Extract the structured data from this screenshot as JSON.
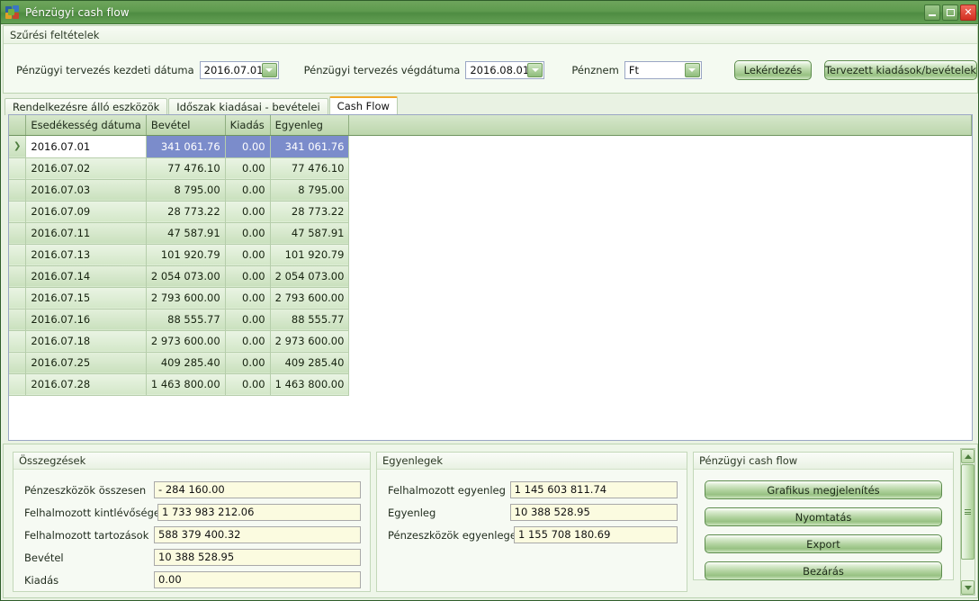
{
  "window": {
    "title": "Pénzügyi cash flow",
    "icon": "app-icon",
    "minimize_label": "",
    "maximize_label": "",
    "close_label": "✕"
  },
  "filter_panel": {
    "caption": "Szűrési feltételek",
    "start_date_label": "Pénzügyi tervezés kezdeti dátuma",
    "start_date_value": "2016.07.01",
    "end_date_label": "Pénzügyi tervezés végdátuma",
    "end_date_value": "2016.08.01",
    "currency_label": "Pénznem",
    "currency_value": "Ft",
    "query_button": "Lekérdezés",
    "planned_button": "Tervezett kiadások/bevételek"
  },
  "tabs": [
    {
      "label": "Rendelkezésre álló eszközök",
      "active": false
    },
    {
      "label": "Időszak kiadásai - bevételei",
      "active": false
    },
    {
      "label": "Cash Flow",
      "active": true
    }
  ],
  "grid": {
    "columns": [
      "Esedékesség dátuma",
      "Bevétel",
      "Kiadás",
      "Egyenleg"
    ],
    "selected_row_index": 0,
    "rows": [
      {
        "date": "2016.07.01",
        "income": "341 061.76",
        "expense": "0.00",
        "balance": "341 061.76"
      },
      {
        "date": "2016.07.02",
        "income": "77 476.10",
        "expense": "0.00",
        "balance": "77 476.10"
      },
      {
        "date": "2016.07.03",
        "income": "8 795.00",
        "expense": "0.00",
        "balance": "8 795.00"
      },
      {
        "date": "2016.07.09",
        "income": "28 773.22",
        "expense": "0.00",
        "balance": "28 773.22"
      },
      {
        "date": "2016.07.11",
        "income": "47 587.91",
        "expense": "0.00",
        "balance": "47 587.91"
      },
      {
        "date": "2016.07.13",
        "income": "101 920.79",
        "expense": "0.00",
        "balance": "101 920.79"
      },
      {
        "date": "2016.07.14",
        "income": "2 054 073.00",
        "expense": "0.00",
        "balance": "2 054 073.00"
      },
      {
        "date": "2016.07.15",
        "income": "2 793 600.00",
        "expense": "0.00",
        "balance": "2 793 600.00"
      },
      {
        "date": "2016.07.16",
        "income": "88 555.77",
        "expense": "0.00",
        "balance": "88 555.77"
      },
      {
        "date": "2016.07.18",
        "income": "2 973 600.00",
        "expense": "0.00",
        "balance": "2 973 600.00"
      },
      {
        "date": "2016.07.25",
        "income": "409 285.40",
        "expense": "0.00",
        "balance": "409 285.40"
      },
      {
        "date": "2016.07.28",
        "income": "1 463 800.00",
        "expense": "0.00",
        "balance": "1 463 800.00"
      }
    ]
  },
  "summary_box": {
    "caption": "Összegzések",
    "fields": [
      {
        "label": "Pénzeszközök összesen",
        "value": "- 284 160.00"
      },
      {
        "label": "Felhalmozott kintlévőségek",
        "value": "1 733 983 212.06"
      },
      {
        "label": "Felhalmozott tartozások",
        "value": "588 379 400.32"
      },
      {
        "label": "Bevétel",
        "value": "10 388 528.95"
      },
      {
        "label": "Kiadás",
        "value": "0.00"
      }
    ]
  },
  "balances_box": {
    "caption": "Egyenlegek",
    "fields": [
      {
        "label": "Felhalmozott egyenleg",
        "value": "1 145 603 811.74"
      },
      {
        "label": "Egyenleg",
        "value": "10 388 528.95"
      },
      {
        "label": "Pénzeszközök egyenlege",
        "value": "1 155 708 180.69"
      }
    ]
  },
  "actions_box": {
    "caption": "Pénzügyi cash flow",
    "buttons": [
      {
        "label": "Grafikus megjelenítés"
      },
      {
        "label": "Nyomtatás"
      },
      {
        "label": "Export"
      },
      {
        "label": "Bezárás"
      }
    ]
  },
  "colors": {
    "titlebar": "#5e9a4e",
    "accent_tab": "#f0a72a",
    "selection": "#7b8ccb",
    "field_bg": "#fbfbe0",
    "grid_row": "#c9e0bd"
  }
}
